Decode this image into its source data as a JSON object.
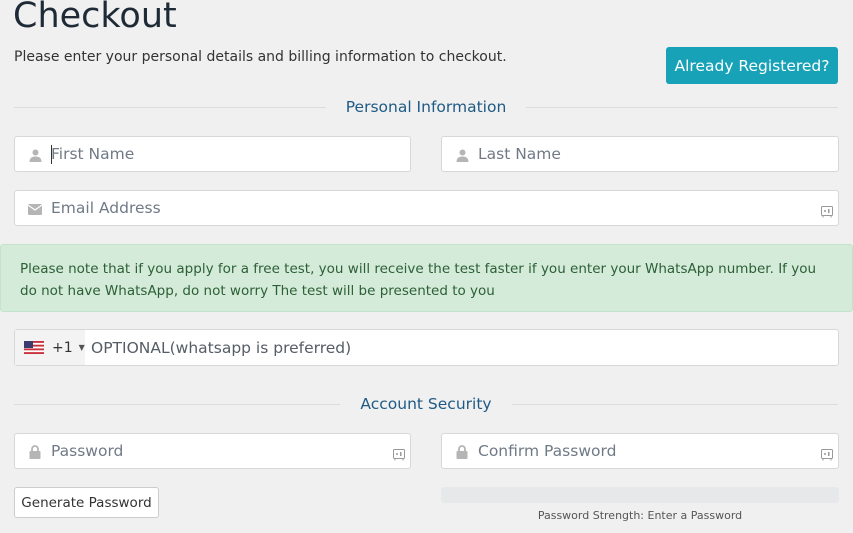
{
  "page": {
    "title": "Checkout",
    "subtitle": "Please enter your personal details and billing information to checkout.",
    "already_registered_label": "Already Registered?"
  },
  "sections": {
    "personal": "Personal Information",
    "security": "Account Security"
  },
  "fields": {
    "first_name": {
      "placeholder": "First Name",
      "value": ""
    },
    "last_name": {
      "placeholder": "Last Name",
      "value": ""
    },
    "email": {
      "placeholder": "Email Address",
      "value": ""
    },
    "phone": {
      "country": "US",
      "dial_code": "+1",
      "placeholder": "OPTIONAL(whatsapp is preferred)",
      "value": ""
    },
    "password": {
      "placeholder": "Password",
      "value": ""
    },
    "confirm_password": {
      "placeholder": "Confirm Password",
      "value": ""
    }
  },
  "notice": "Please note that if you apply for a free test, you will receive the test faster if you enter your WhatsApp number. If you do not have WhatsApp, do not worry The test will be presented to you",
  "password_tools": {
    "generate_label": "Generate Password",
    "strength_percent": 0,
    "strength_text": "Password Strength: Enter a Password"
  },
  "colors": {
    "accent": "#17a2b8",
    "section_heading": "#1f5a85",
    "notice_bg": "#d4ebd9"
  }
}
